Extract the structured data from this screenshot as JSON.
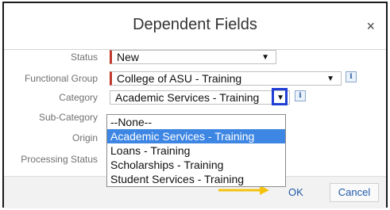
{
  "dialog": {
    "title": "Dependent Fields",
    "close_glyph": "×"
  },
  "fields": {
    "status": {
      "label": "Status",
      "value": "New"
    },
    "functional_group": {
      "label": "Functional Group",
      "value": "College of ASU - Training"
    },
    "category": {
      "label": "Category",
      "value": "Academic Services - Training"
    },
    "sub_category": {
      "label": "Sub-Category"
    },
    "origin": {
      "label": "Origin"
    },
    "processing_status": {
      "label": "Processing Status"
    }
  },
  "dropdown": {
    "options": [
      "--None--",
      "Academic Services - Training",
      "Loans - Training",
      "Scholarships - Training",
      "Student Services - Training"
    ],
    "selected_index": 1
  },
  "icons": {
    "arrow": "▼",
    "info": "i"
  },
  "footer": {
    "ok_label": "OK",
    "cancel_label": "Cancel"
  },
  "colors": {
    "required": "#c0392b",
    "selected_bg": "#3e86e3",
    "highlight_box": "#1f3fd6",
    "arrow_annotation": "#f4c20d",
    "link": "#1e5aa8"
  }
}
